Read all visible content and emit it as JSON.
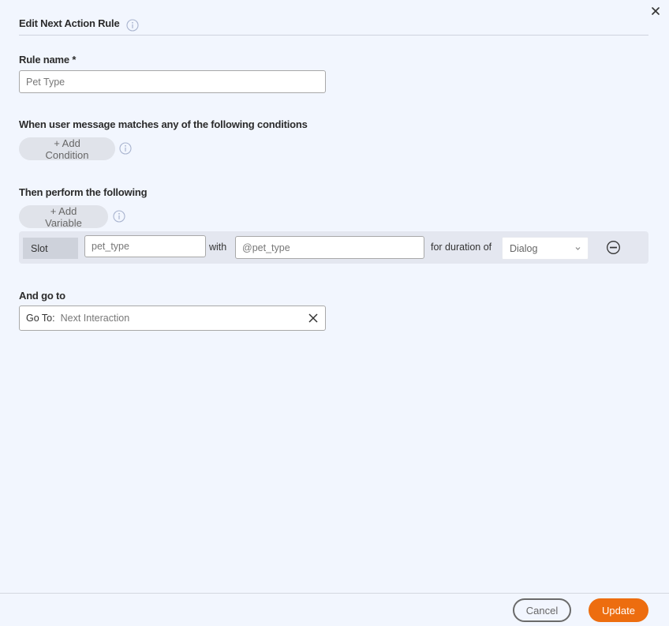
{
  "dialog": {
    "title": "Edit Next Action Rule",
    "close_icon": "close-icon"
  },
  "rule_name": {
    "label": "Rule name *",
    "value": "Pet Type"
  },
  "conditions": {
    "label": "When user message matches any of the following conditions",
    "add_button": "+ Add Condition"
  },
  "actions": {
    "label": "Then perform the following",
    "add_button": "+ Add Variable",
    "rows": [
      {
        "type": "Slot",
        "slot_name": "pet_type",
        "with_label": "with",
        "value": "@pet_type",
        "duration_label": "for duration of",
        "duration": "Dialog"
      }
    ]
  },
  "goto": {
    "label": "And go to",
    "prefix": "Go To:",
    "value": "Next Interaction"
  },
  "footer": {
    "cancel": "Cancel",
    "update": "Update"
  },
  "colors": {
    "background": "#f2f6fe",
    "primary": "#ed6d0f",
    "info_icon": "#a9b4cf"
  }
}
